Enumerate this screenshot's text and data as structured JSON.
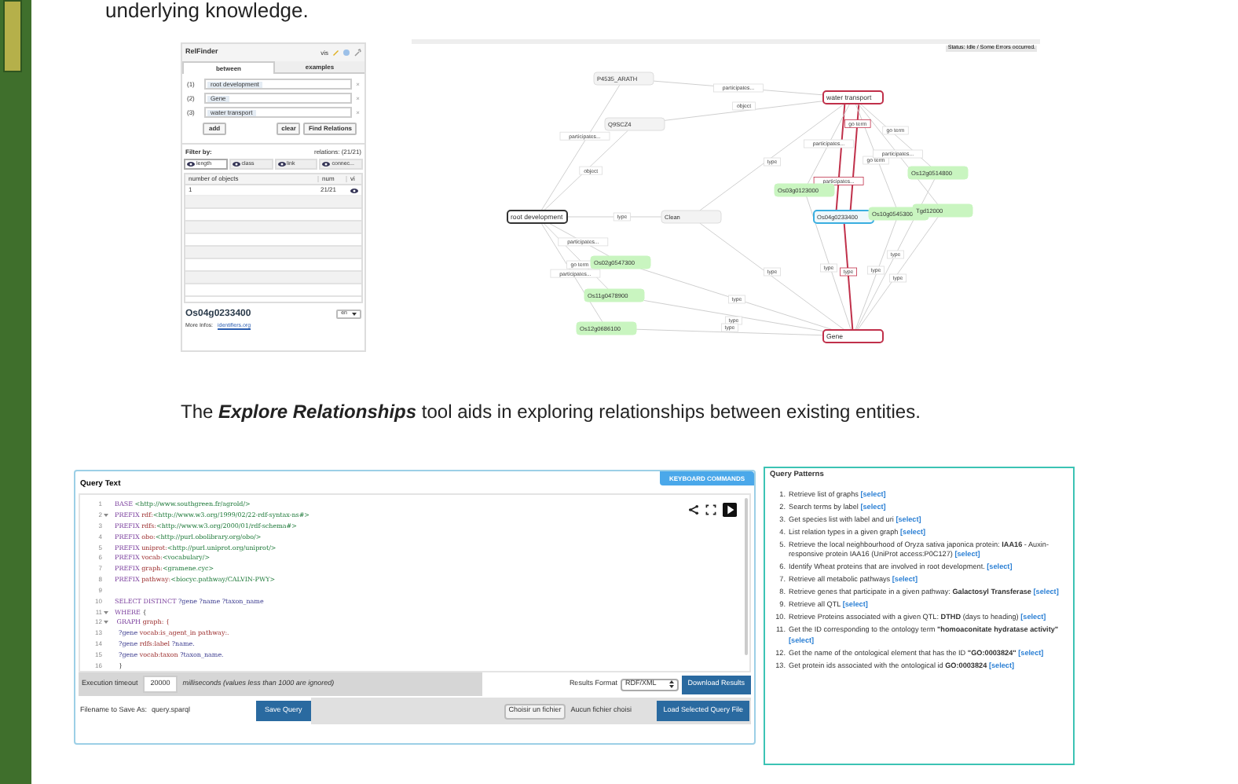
{
  "intro_text": "underlying knowledge.",
  "relfinder": {
    "title": "RelFinder",
    "vis_label": "vis",
    "tabs": [
      {
        "label": "between",
        "selected": true
      },
      {
        "label": "examples",
        "selected": false
      }
    ],
    "inputs": [
      {
        "index": "(1)",
        "value": "root development",
        "remove": "×"
      },
      {
        "index": "(2)",
        "value": "Gene",
        "remove": "×"
      },
      {
        "index": "(3)",
        "value": "water transport",
        "remove": "×"
      }
    ],
    "buttons": {
      "add": "add",
      "clear": "clear",
      "find": "Find Relations"
    },
    "filter_label": "Filter by:",
    "relations_count": "relations: (21/21)",
    "filter_tabs": [
      {
        "label": "length",
        "selected": true
      },
      {
        "label": "class",
        "selected": false
      },
      {
        "label": "link",
        "selected": false
      },
      {
        "label": "connec...",
        "selected": false
      }
    ],
    "table": {
      "columns": [
        "number of objects",
        "num",
        "vi"
      ],
      "rows": [
        {
          "cells": [
            "1",
            "21/21"
          ],
          "visible": true
        }
      ]
    },
    "entity": "Os04g0233400",
    "language": "en",
    "more_label": "More Infos:",
    "more_link": "identifiers.org"
  },
  "graph": {
    "status": "Status: Idle / Some Errors occurred.",
    "nodes": [
      {
        "label": "root development",
        "kind": "start"
      },
      {
        "label": "water transport",
        "kind": "end"
      },
      {
        "label": "Gene",
        "kind": "end"
      },
      {
        "label": "P4535_ARATH",
        "kind": "class"
      },
      {
        "label": "Q9SCZ4",
        "kind": "class"
      },
      {
        "label": "Clean",
        "kind": "class"
      },
      {
        "label": "Os04g0233400",
        "kind": "selected"
      },
      {
        "label": "Os03g0123000",
        "kind": "instance"
      },
      {
        "label": "Os12g0514800",
        "kind": "instance"
      },
      {
        "label": "Os10g0545300",
        "kind": "instance"
      },
      {
        "label": "Tgd12000",
        "kind": "instance"
      },
      {
        "label": "Os02g0547300",
        "kind": "instance"
      },
      {
        "label": "Os11g0478900",
        "kind": "instance"
      },
      {
        "label": "Os12g0686100",
        "kind": "instance"
      }
    ],
    "edges": [
      {
        "label": "participates...",
        "highlighted": false
      },
      {
        "label": "participates...",
        "highlighted": false
      },
      {
        "label": "object",
        "highlighted": false
      },
      {
        "label": "object",
        "highlighted": false
      },
      {
        "label": "type",
        "highlighted": false
      },
      {
        "label": "type",
        "highlighted": false
      },
      {
        "label": "type",
        "highlighted": false
      },
      {
        "label": "participates...",
        "highlighted": false
      },
      {
        "label": "go term",
        "highlighted": false
      },
      {
        "label": "participates...",
        "highlighted": false
      },
      {
        "label": "type",
        "highlighted": false
      },
      {
        "label": "type",
        "highlighted": false
      },
      {
        "label": "type",
        "highlighted": false
      },
      {
        "label": "participates...",
        "highlighted": true
      },
      {
        "label": "go term",
        "highlighted": true
      },
      {
        "label": "type",
        "highlighted": true
      },
      {
        "label": "participates...",
        "highlighted": false
      },
      {
        "label": "type",
        "highlighted": false
      },
      {
        "label": "go term",
        "highlighted": false
      },
      {
        "label": "type",
        "highlighted": false
      },
      {
        "label": "go term",
        "highlighted": false
      },
      {
        "label": "type",
        "highlighted": false
      },
      {
        "label": "participates...",
        "highlighted": false
      },
      {
        "label": "type",
        "highlighted": false
      }
    ]
  },
  "caption": "The **Explore Relationships** tool aids in exploring  relationships between existing entities.",
  "query_editor": {
    "title": "Query Text",
    "keyboard_button": "KEYBOARD COMMANDS",
    "lines": [
      {
        "num": "1",
        "fold": false,
        "segments": [
          {
            "t": "BASE ",
            "kind": "keyword"
          },
          {
            "t": "<http://www.southgreen.fr/agrold/>",
            "kind": "uri"
          }
        ]
      },
      {
        "num": "2",
        "fold": true,
        "segments": [
          {
            "t": "PREFIX ",
            "kind": "keyword"
          },
          {
            "t": "rdf:",
            "kind": "prefix"
          },
          {
            "t": "<http://www.w3.org/1999/02/22-rdf-syntax-ns#>",
            "kind": "uri"
          }
        ]
      },
      {
        "num": "3",
        "fold": false,
        "segments": [
          {
            "t": "PREFIX ",
            "kind": "keyword"
          },
          {
            "t": "rdfs:",
            "kind": "prefix"
          },
          {
            "t": "<http://www.w3.org/2000/01/rdf-schema#>",
            "kind": "uri"
          }
        ]
      },
      {
        "num": "4",
        "fold": false,
        "segments": [
          {
            "t": "PREFIX ",
            "kind": "keyword"
          },
          {
            "t": "obo:",
            "kind": "prefix"
          },
          {
            "t": "<http://purl.obolibrary.org/obo/>",
            "kind": "uri"
          }
        ]
      },
      {
        "num": "5",
        "fold": false,
        "segments": [
          {
            "t": "PREFIX ",
            "kind": "keyword"
          },
          {
            "t": "uniprot:",
            "kind": "prefix"
          },
          {
            "t": "<http://purl.uniprot.org/uniprot/>",
            "kind": "uri"
          }
        ]
      },
      {
        "num": "6",
        "fold": false,
        "segments": [
          {
            "t": "PREFIX ",
            "kind": "keyword"
          },
          {
            "t": "vocab:",
            "kind": "prefix"
          },
          {
            "t": "<vocabulary/>",
            "kind": "uri"
          }
        ]
      },
      {
        "num": "7",
        "fold": false,
        "segments": [
          {
            "t": "PREFIX ",
            "kind": "keyword"
          },
          {
            "t": "graph:",
            "kind": "prefix"
          },
          {
            "t": "<gramene.cyc>",
            "kind": "uri"
          }
        ]
      },
      {
        "num": "8",
        "fold": false,
        "segments": [
          {
            "t": "PREFIX ",
            "kind": "keyword"
          },
          {
            "t": "pathway:",
            "kind": "prefix"
          },
          {
            "t": "<biocyc.pathway/CALVIN-PWY>",
            "kind": "uri"
          }
        ]
      },
      {
        "num": "9",
        "fold": false
      },
      {
        "num": "10",
        "fold": false,
        "segments": [
          {
            "t": "SELECT DISTINCT ",
            "kind": "keyword"
          },
          {
            "t": "?gene ?name ?taxon_name",
            "kind": "variable"
          }
        ]
      },
      {
        "num": "11",
        "fold": true,
        "segments": [
          {
            "t": "WHERE ",
            "kind": "keyword"
          },
          {
            "t": "{",
            "kind": "plain"
          }
        ]
      },
      {
        "num": "12",
        "fold": true,
        "segments": [
          {
            "t": " GRAPH ",
            "kind": "keyword"
          },
          {
            "t": "graph: {",
            "kind": "prefix"
          }
        ]
      },
      {
        "num": "13",
        "fold": false,
        "segments": [
          {
            "t": "  ?gene ",
            "kind": "variable"
          },
          {
            "t": "vocab:is_agent_in pathway:.",
            "kind": "prefix"
          }
        ]
      },
      {
        "num": "14",
        "fold": false,
        "segments": [
          {
            "t": "  ?gene ",
            "kind": "variable"
          },
          {
            "t": "rdfs:label ",
            "kind": "prefix"
          },
          {
            "t": "?name.",
            "kind": "variable"
          }
        ]
      },
      {
        "num": "15",
        "fold": false,
        "segments": [
          {
            "t": "  ?gene ",
            "kind": "variable"
          },
          {
            "t": "vocab:taxon ",
            "kind": "prefix"
          },
          {
            "t": "?taxon_name.",
            "kind": "variable"
          }
        ]
      },
      {
        "num": "16",
        "fold": false,
        "segments": [
          {
            "t": "  }",
            "kind": "plain"
          }
        ]
      }
    ],
    "timeout_label": "Execution timeout",
    "timeout_value": "20000",
    "timeout_note": "milliseconds (values less than 1000 are ignored)",
    "format_label": "Results Format",
    "format_value": "RDF/XML",
    "download_button": "Download Results",
    "filename_label": "Filename to Save As:",
    "filename_value": "query.sparql",
    "save_button": "Save Query",
    "file_button": "Choisir un fichier",
    "file_status": "Aucun fichier choisi",
    "load_button": "Load Selected Query File"
  },
  "query_patterns": {
    "title": "Query Patterns",
    "items": [
      {
        "num": "1.",
        "text": "Retrieve list of graphs",
        "link": "[select]"
      },
      {
        "num": "2.",
        "text": "Search terms by label",
        "link": "[select]"
      },
      {
        "num": "3.",
        "text": "Get species list with label and uri",
        "link": "[select]"
      },
      {
        "num": "4.",
        "text": "List relation types in a given graph",
        "link": "[select]"
      },
      {
        "num": "5.",
        "text": "Retrieve the local neighbourhood of Oryza sativa japonica protein: **IAA16** - Auxin-responsive protein IAA16 (UniProt access:P0C127)",
        "link": "[select]"
      },
      {
        "num": "6.",
        "text": "Identify Wheat proteins that are involved in root development.",
        "link": "[select]"
      },
      {
        "num": "7.",
        "text": "Retrieve all metabolic pathways",
        "link": "[select]"
      },
      {
        "num": "8.",
        "text": "Retrieve genes that participate in a given pathway: **Galactosyl Transferase**",
        "link": "[select]"
      },
      {
        "num": "9.",
        "text": "Retrieve all QTL",
        "link": "[select]"
      },
      {
        "num": "10.",
        "text": "Retrieve Proteins associated with a given QTL: **DTHD** (days to heading)",
        "link": "[select]"
      },
      {
        "num": "11.",
        "text": "Get the ID corresponding to the ontology term **\"homoaconitate hydratase activity\"**",
        "link": "[select]"
      },
      {
        "num": "12.",
        "text": "Get the name of the ontological element that has the ID **\"GO:0003824\"**",
        "link": "[select]"
      },
      {
        "num": "13.",
        "text": "Get protein ids associated with the ontological id **GO:0003824**",
        "link": "[select]"
      }
    ]
  }
}
